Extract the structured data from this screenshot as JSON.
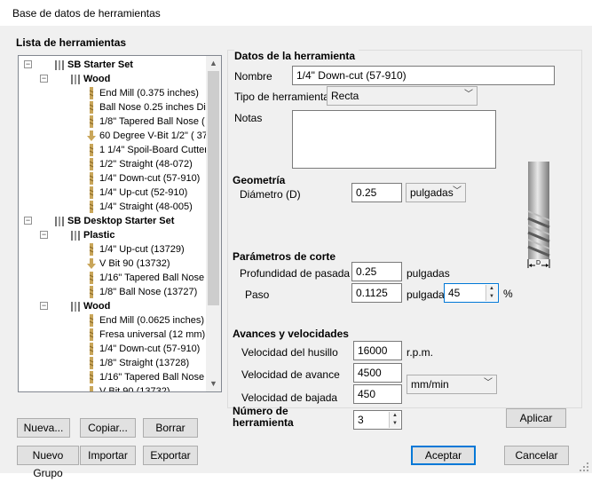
{
  "window": {
    "title": "Base de datos de herramientas"
  },
  "tree": {
    "heading": "Lista de herramientas",
    "rows": [
      {
        "label": "SB Starter Set",
        "level": 0,
        "kind": "set",
        "bold": true
      },
      {
        "label": "Wood",
        "level": 1,
        "kind": "group",
        "bold": true
      },
      {
        "label": "End Mill (0.375 inches)",
        "level": 2,
        "kind": "tool"
      },
      {
        "label": "Ball Nose 0.25 inches Dia",
        "level": 2,
        "kind": "tool"
      },
      {
        "label": "1/8\" Tapered Ball Nose ( 77",
        "level": 2,
        "kind": "tool"
      },
      {
        "label": "60 Degree V-Bit 1/2\" ( 37-8",
        "level": 2,
        "kind": "vbit"
      },
      {
        "label": "1 1/4\" Spoil-Board Cutter (",
        "level": 2,
        "kind": "tool"
      },
      {
        "label": "1/2\" Straight (48-072)",
        "level": 2,
        "kind": "tool"
      },
      {
        "label": "1/4\" Down-cut (57-910)",
        "level": 2,
        "kind": "tool"
      },
      {
        "label": "1/4\" Up-cut (52-910)",
        "level": 2,
        "kind": "tool"
      },
      {
        "label": "1/4\" Straight (48-005)",
        "level": 2,
        "kind": "tool"
      },
      {
        "label": "SB Desktop Starter Set",
        "level": 0,
        "kind": "set",
        "bold": true
      },
      {
        "label": "Plastic",
        "level": 1,
        "kind": "group",
        "bold": true
      },
      {
        "label": "1/4\" Up-cut (13729)",
        "level": 2,
        "kind": "tool"
      },
      {
        "label": "V Bit 90 (13732)",
        "level": 2,
        "kind": "vbit"
      },
      {
        "label": "1/16\" Tapered Ball Nose (1",
        "level": 2,
        "kind": "tool"
      },
      {
        "label": "1/8\" Ball Nose (13727)",
        "level": 2,
        "kind": "tool"
      },
      {
        "label": "Wood",
        "level": 1,
        "kind": "group",
        "bold": true
      },
      {
        "label": "End Mill (0.0625 inches)",
        "level": 2,
        "kind": "tool"
      },
      {
        "label": "Fresa universal (12 mm)",
        "level": 2,
        "kind": "tool"
      },
      {
        "label": "1/4\" Down-cut (57-910)",
        "level": 2,
        "kind": "tool"
      },
      {
        "label": "1/8\" Straight (13728)",
        "level": 2,
        "kind": "tool"
      },
      {
        "label": "1/16\" Tapered Ball Nose (1",
        "level": 2,
        "kind": "tool"
      },
      {
        "label": "V Bit 90 (13732)",
        "level": 2,
        "kind": "vbit"
      }
    ]
  },
  "left_buttons": {
    "nueva": "Nueva...",
    "copiar": "Copiar...",
    "borrar": "Borrar",
    "nuevo_grupo": "Nuevo Grupo",
    "importar": "Importar",
    "exportar": "Exportar"
  },
  "details": {
    "heading": "Datos de la herramienta",
    "nombre_label": "Nombre",
    "nombre_value": "1/4\"  Down-cut (57-910)",
    "tipo_label": "Tipo de herramienta",
    "tipo_value": "Recta",
    "notas_label": "Notas",
    "notas_value": "",
    "geometria_heading": "Geometría",
    "diametro_label": "Diámetro (D)",
    "diametro_value": "0.25",
    "diametro_units": "pulgadas",
    "diagram_label": "D",
    "corte_heading": "Parámetros de corte",
    "profundidad_label": "Profundidad de pasada",
    "profundidad_value": "0.25",
    "profundidad_units": "pulgadas",
    "paso_label": "Paso",
    "paso_value": "0.1125",
    "paso_units": "pulgadas",
    "paso_percent_value": "45",
    "paso_percent_sign": "%",
    "avances_heading": "Avances y velocidades",
    "husillo_label": "Velocidad del husillo",
    "husillo_value": "16000",
    "husillo_units": "r.p.m.",
    "avance_label": "Velocidad de avance",
    "avance_value": "4500",
    "bajada_label": "Velocidad de bajada",
    "bajada_value": "450",
    "feed_units": "mm/min",
    "numero_label_line1": "Número de",
    "numero_label_line2": "herramienta",
    "numero_value": "3",
    "aplicar": "Aplicar"
  },
  "footer": {
    "aceptar": "Aceptar",
    "cancelar": "Cancelar"
  },
  "colors": {
    "accent": "#0078d7",
    "tree_line": "#a0a0a0",
    "tool_gold": "#c9a65a"
  }
}
